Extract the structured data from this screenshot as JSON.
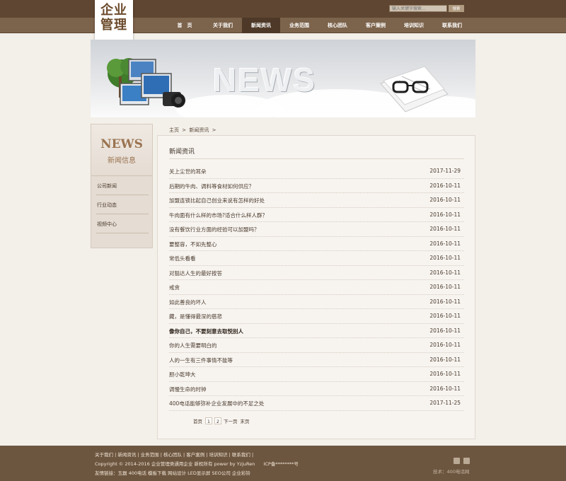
{
  "header": {
    "logo_line1": "企业",
    "logo_line2": "管理",
    "search_placeholder": "输入关键字搜索…",
    "search_button": "搜索"
  },
  "nav": [
    {
      "label": "首　页",
      "active": false
    },
    {
      "label": "关于我们",
      "active": false
    },
    {
      "label": "新闻资讯",
      "active": true
    },
    {
      "label": "业务范围",
      "active": false
    },
    {
      "label": "核心团队",
      "active": false
    },
    {
      "label": "客户案例",
      "active": false
    },
    {
      "label": "培训知识",
      "active": false
    },
    {
      "label": "联系我们",
      "active": false
    }
  ],
  "banner": {
    "word": "NEWS"
  },
  "sidebar": {
    "title_en": "NEWS",
    "title_cn": "新闻信息",
    "items": [
      "公司新闻",
      "行业动态",
      "视频中心"
    ]
  },
  "breadcrumb": {
    "home": "主页",
    "sep1": ">",
    "current": "新闻资讯",
    "sep2": ">"
  },
  "main": {
    "title": "新闻资讯",
    "articles": [
      {
        "title": "关上尘世的耳朵",
        "date": "2017-11-29",
        "bold": false
      },
      {
        "title": "后期的牛肉、调料等食材如何供应？",
        "date": "2016-10-11",
        "bold": false
      },
      {
        "title": "加盟连锁比起自己创业来说有怎样的好处",
        "date": "2016-10-11",
        "bold": false
      },
      {
        "title": "牛肉面有什么样的市场?适合什么样人群？",
        "date": "2016-10-11",
        "bold": false
      },
      {
        "title": "没有餐饮行业方面的经验可以加盟吗？",
        "date": "2016-10-11",
        "bold": false
      },
      {
        "title": "要整容，不如先整心",
        "date": "2016-10-11",
        "bold": false
      },
      {
        "title": "常低头看看",
        "date": "2016-10-11",
        "bold": false
      },
      {
        "title": "对豁达人生的最好按答",
        "date": "2016-10-11",
        "bold": false
      },
      {
        "title": "戒贪",
        "date": "2016-10-11",
        "bold": false
      },
      {
        "title": "如此善良的坏人",
        "date": "2016-10-11",
        "bold": false
      },
      {
        "title": "藏，是懂得最深的慈悲",
        "date": "2016-10-11",
        "bold": false
      },
      {
        "title": "像你自己，不要刻意去取悦别人",
        "date": "2016-10-11",
        "bold": true
      },
      {
        "title": "你的人生需要明白的",
        "date": "2016-10-11",
        "bold": false
      },
      {
        "title": "人的一生有三件事情不能等",
        "date": "2016-10-11",
        "bold": false
      },
      {
        "title": "胆小乾坤大",
        "date": "2016-10-11",
        "bold": false
      },
      {
        "title": "调慢生命的时钟",
        "date": "2016-10-11",
        "bold": false
      },
      {
        "title": "400电话能够弥补企业发展中的不足之处",
        "date": "2017-11-25",
        "bold": false
      }
    ]
  },
  "pager": {
    "first": "首页",
    "pages": [
      "1",
      "2"
    ],
    "next": "下一页",
    "last": "末页"
  },
  "footer": {
    "links": "关于我们 | 新闻资讯 | 业务范围 | 核心团队 | 客户案例 | 培训知识 | 联系我们 |",
    "copyright": "Copyright © 2014-2016 企业管理类通用企业 新权所有 power by YzjuRen",
    "icp": "ICP备********号",
    "friend_label": "友情链接：",
    "friend_links": "玉器  400电话  模板下载  网站设计  LED显示屏  SEO公司  企业彩铃",
    "support": "技术：400电话网"
  }
}
